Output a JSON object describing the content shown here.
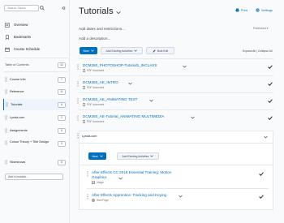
{
  "sidebar": {
    "search_placeholder": "Search Topics",
    "nav": [
      {
        "label": "Overview"
      },
      {
        "label": "Bookmarks"
      },
      {
        "label": "Course Schedule"
      }
    ],
    "toc_title": "Table of Contents",
    "toc_count": "42",
    "modules": [
      {
        "label": "Course Info",
        "count": "7"
      },
      {
        "label": "Reference",
        "count": "11"
      },
      {
        "label": "Tutorials",
        "count": "6"
      },
      {
        "label": "Lynda.com",
        "count": "2"
      },
      {
        "label": "Assignments",
        "count": "5"
      },
      {
        "label": "Colour Theory + Title Design",
        "count": "3"
      },
      {
        "label": "Slideshows",
        "count": "6"
      }
    ],
    "add_module": "Add a module..."
  },
  "header": {
    "title": "Tutorials",
    "print": "Print",
    "settings": "Settings",
    "dates": "Add dates and restrictions...",
    "published": "Published",
    "description": "Add a description...",
    "new_label": "New",
    "add_existing": "Add Existing Activities",
    "bulk_edit": "Bulk Edit",
    "expand_collapse": "Expand All  |  Collapse All"
  },
  "items": [
    {
      "title": "DCM260_PHOTOSHOP-Tutorial1_INCLASS",
      "sub": "PDF document"
    },
    {
      "title": "DCM260_AE_INTRO",
      "sub": "PDF document"
    },
    {
      "title": "DCM260_AE_ANIMATING TEXT",
      "sub": "PDF document"
    },
    {
      "title": "DCM260_AE-Tutorial_ANIMATING MULTIMEDIA",
      "sub": "PDF document"
    }
  ],
  "lynda": {
    "label": "Lynda.com",
    "new_label": "New",
    "add_existing": "Add Existing Activities",
    "items": [
      {
        "title_line1": "After Effects CC 2018 Essential Training: Motion",
        "title_line2": "Graphics",
        "sub": "Image"
      },
      {
        "title_line1": "After Effects Apprentice: Tracking and Keying",
        "title_line2": "",
        "sub": "Web Page"
      }
    ]
  },
  "colors": {
    "accent": "#006fbf",
    "active_bg": "#edf4fb"
  }
}
